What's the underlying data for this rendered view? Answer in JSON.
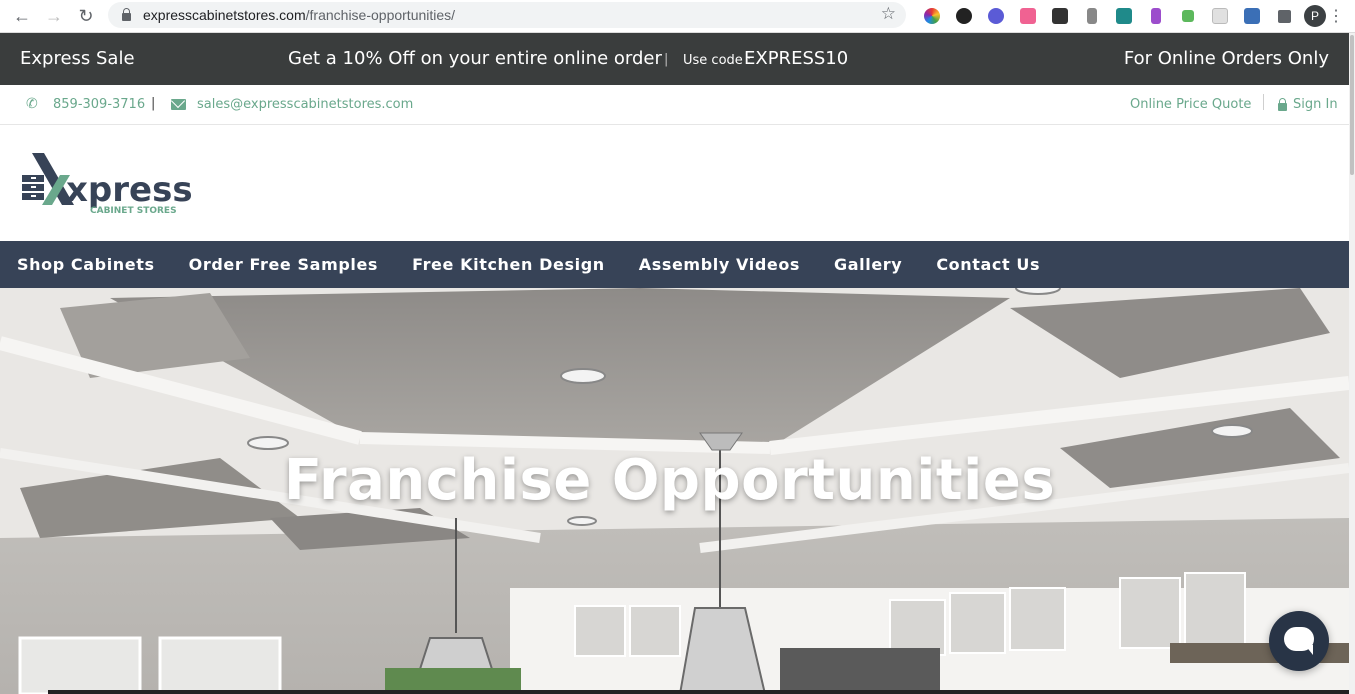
{
  "browser": {
    "url_host": "expresscabinetstores.com",
    "url_path": "/franchise-opportunities/",
    "profile_initial": "P"
  },
  "promo": {
    "left": "Express Sale",
    "message": "Get a 10% Off on your entire online order",
    "separator": "|",
    "code_label": "Use code :",
    "code": "EXPRESS10",
    "right": "For Online Orders Only"
  },
  "contact": {
    "phone": "859-309-3716",
    "separator": "|",
    "email": "sales@expresscabinetstores.com",
    "quote_link": "Online Price Quote",
    "signin_link": "Sign In"
  },
  "logo": {
    "word": "xpress",
    "tagline": "CABINET STORES"
  },
  "nav": {
    "items": [
      "Shop Cabinets",
      "Order Free Samples",
      "Free Kitchen Design",
      "Assembly Videos",
      "Gallery",
      "Contact Us"
    ]
  },
  "hero": {
    "title": "Franchise Opportunities"
  },
  "colors": {
    "promo_bg": "#3a3d3d",
    "accent_green": "#6aa88c",
    "nav_bg": "#374357",
    "chat_bg": "#283446"
  }
}
